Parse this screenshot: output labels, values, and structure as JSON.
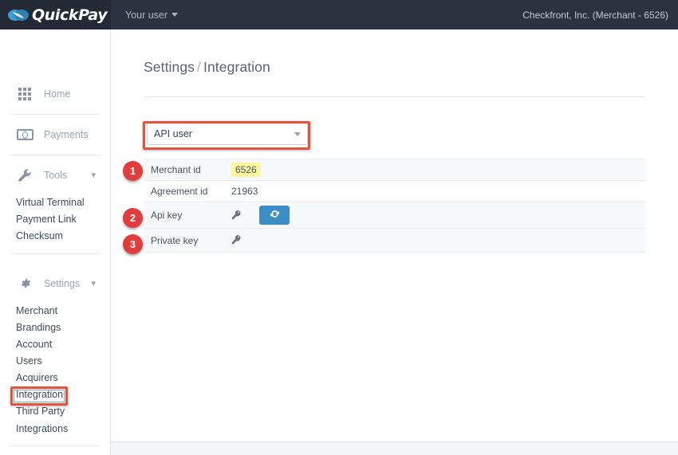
{
  "topbar": {
    "brand": "QuickPay",
    "brand_logo_icon": "quickpay-swirl-logo",
    "user_menu": "Your user",
    "account": "Checkfront, Inc. (Merchant - 6526)"
  },
  "sidebar": {
    "home": {
      "label": "Home",
      "icon": "grid-icon"
    },
    "payments": {
      "label": "Payments",
      "icon": "banknote-icon"
    },
    "tools": {
      "label": "Tools",
      "icon": "wrench-icon",
      "chevron": "chevron-down-icon",
      "items": [
        {
          "label": "Virtual Terminal"
        },
        {
          "label": "Payment Link"
        },
        {
          "label": "Checksum"
        }
      ]
    },
    "settings": {
      "label": "Settings",
      "icon": "gear-icon",
      "chevron": "chevron-down-icon",
      "items": [
        {
          "label": "Merchant"
        },
        {
          "label": "Brandings"
        },
        {
          "label": "Account"
        },
        {
          "label": "Users"
        },
        {
          "label": "Acquirers"
        },
        {
          "label": "Integration",
          "highlighted": true
        },
        {
          "label": "Third Party"
        },
        {
          "label": "Integrations"
        }
      ]
    }
  },
  "main": {
    "breadcrumb": {
      "root": "Settings",
      "separator": "/",
      "current": "Integration"
    },
    "api_select": {
      "value": "API user",
      "caret_icon": "caret-down-icon",
      "highlighted": true
    },
    "rows": [
      {
        "label": "Merchant id",
        "value": "6526",
        "highlight": "yellow",
        "badge": "1"
      },
      {
        "label": "Agreement id",
        "value": "21963",
        "highlight": "none",
        "badge": ""
      },
      {
        "label": "Api key",
        "value": "",
        "icon": "key-icon",
        "button_icon": "refresh-icon",
        "badge": "2"
      },
      {
        "label": "Private key",
        "value": "",
        "icon": "key-icon",
        "badge": "3"
      }
    ]
  },
  "colors": {
    "topbar_bg": "#2b3341",
    "brand_bg": "#232a36",
    "annotation_red": "#e4533c",
    "badge_red": "#e23d3d",
    "button_blue": "#3c8dc5",
    "highlight_yellow": "#fbf7a0",
    "page_bg": "#f4f5f7"
  }
}
